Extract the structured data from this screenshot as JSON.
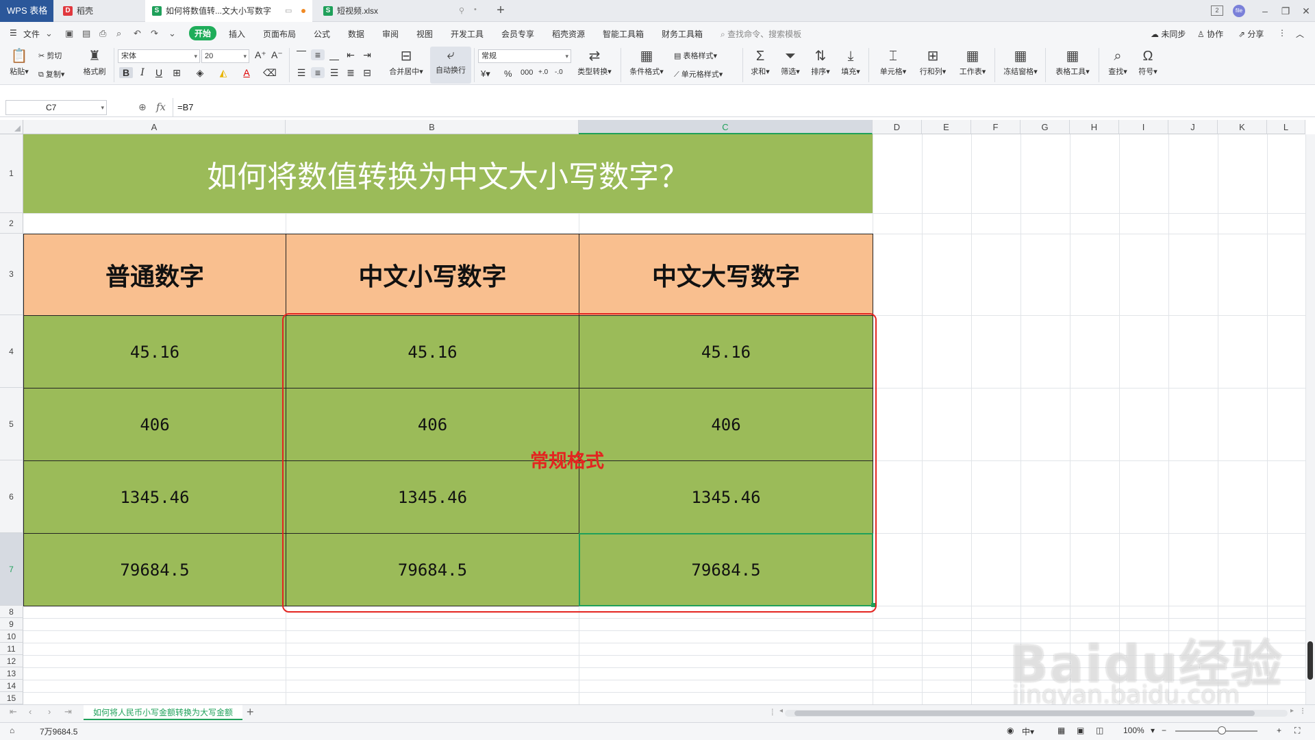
{
  "app": {
    "name": "WPS 表格"
  },
  "tabs": [
    {
      "label": "稻壳"
    },
    {
      "label": "如何将数值转...文大小写数字"
    },
    {
      "label": "短视频.xlsx"
    }
  ],
  "menu": {
    "file": "文件",
    "items": [
      "开始",
      "插入",
      "页面布局",
      "公式",
      "数据",
      "审阅",
      "视图",
      "开发工具",
      "会员专享",
      "稻壳资源",
      "智能工具箱",
      "财务工具箱"
    ],
    "search_placeholder": "查找命令、搜索模板",
    "sync": "未同步",
    "collab": "协作",
    "share": "分享"
  },
  "ribbon": {
    "paste": "粘贴",
    "cut": "剪切",
    "copy": "复制",
    "format_painter": "格式刷",
    "font_name": "宋体",
    "font_size": "20",
    "merge_center": "合并居中",
    "wrap_text": "自动换行",
    "number_format": "常规",
    "type_convert": "类型转换",
    "cond_format": "条件格式",
    "table_style": "表格样式",
    "cell_style": "单元格样式",
    "sum": "求和",
    "filter": "筛选",
    "sort": "排序",
    "fill": "填充",
    "cells": "单元格",
    "rows_cols": "行和列",
    "worksheet": "工作表",
    "freeze": "冻结窗格",
    "table_tools": "表格工具",
    "find": "查找",
    "symbol": "符号"
  },
  "formula_bar": {
    "name_box": "C7",
    "formula": "=B7"
  },
  "columns": [
    "A",
    "B",
    "C",
    "D",
    "E",
    "F",
    "G",
    "H",
    "I",
    "J",
    "K",
    "L"
  ],
  "rows": [
    "1",
    "2",
    "3",
    "4",
    "5",
    "6",
    "7",
    "8",
    "9",
    "10",
    "11",
    "12",
    "13",
    "14",
    "15"
  ],
  "sheet": {
    "title": "如何将数值转换为中文大小写数字？",
    "headers": [
      "普通数字",
      "中文小写数字",
      "中文大写数字"
    ],
    "data": [
      [
        "45.16",
        "45.16",
        "45.16"
      ],
      [
        "406",
        "406",
        "406"
      ],
      [
        "1345.46",
        "1345.46",
        "1345.46"
      ],
      [
        "79684.5",
        "79684.5",
        "79684.5"
      ]
    ],
    "annotation": "常规格式"
  },
  "sheet_tab": "如何将人民币小写金额转换为大写金额",
  "status": {
    "value": "7万9684.5",
    "zoom": "100%"
  },
  "watermark": {
    "brand": "Baidu经验",
    "url": "jingyan.baidu.com"
  },
  "colors": {
    "green_fill": "#9bbb59",
    "orange_fill": "#f9bf8f",
    "accent": "#1fa05a",
    "annotation": "#e32420"
  }
}
